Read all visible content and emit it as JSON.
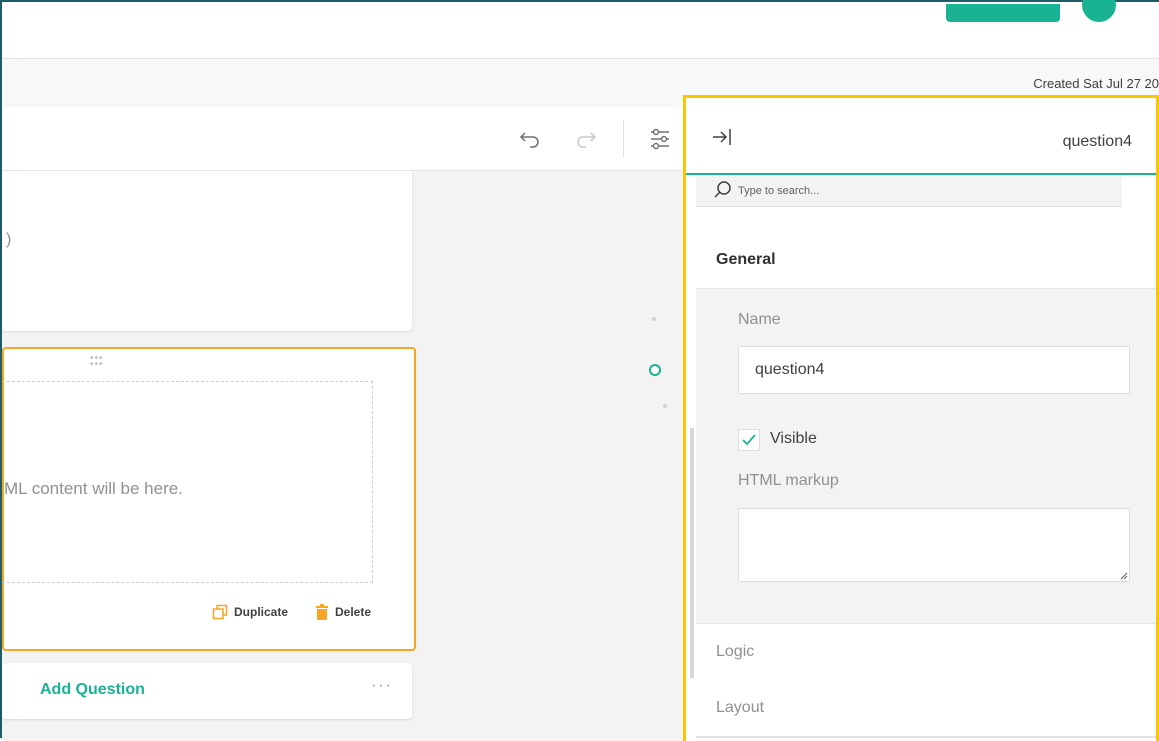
{
  "header": {
    "created_text": "Created Sat Jul 27 20"
  },
  "toolbar": {
    "undo_icon": "undo-icon",
    "redo_icon": "redo-icon",
    "settings_icon": "sliders-icon"
  },
  "canvas": {
    "card1_fragment": ")",
    "html_placeholder": "ML content will be here.",
    "duplicate_label": "Duplicate",
    "delete_label": "Delete",
    "add_question_label": "Add Question",
    "more_label": "···"
  },
  "property_panel": {
    "title": "question4",
    "search_placeholder": "Type to search...",
    "categories": {
      "general": "General",
      "logic": "Logic",
      "layout": "Layout"
    },
    "fields": {
      "name_label": "Name",
      "name_value": "question4",
      "visible_label": "Visible",
      "visible_checked": true,
      "html_markup_label": "HTML markup",
      "html_markup_value": ""
    }
  },
  "colors": {
    "accent": "#19b394",
    "selection": "#f5a623",
    "highlight": "#f6c800",
    "delete": "#f5a623"
  }
}
